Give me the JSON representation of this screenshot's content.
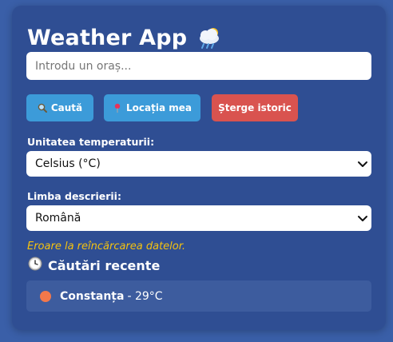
{
  "app": {
    "title": "Weather App"
  },
  "search": {
    "placeholder": "Introdu un oraș...",
    "value": ""
  },
  "buttons": {
    "search_label": "Caută",
    "location_label": "Locația mea",
    "clear_label": "Șterge istoric",
    "search_icon": "magnifier-icon",
    "location_icon": "pin-icon"
  },
  "unit": {
    "label": "Unitatea temperaturii:",
    "selected": "Celsius (°C)"
  },
  "language": {
    "label": "Limba descrierii:",
    "selected": "Română"
  },
  "status": {
    "error": "Eroare la reîncărcarea datelor."
  },
  "recent": {
    "title": "Căutări recente",
    "icon": "clock-icon",
    "items": [
      {
        "city": "Constanța",
        "temp": "- 29°C",
        "dot_color": "#f2784b"
      }
    ]
  },
  "colors": {
    "background": "#3a5fa8",
    "card": "#2f4e93",
    "primary_button": "#3c9bd9",
    "danger_button": "#d9534f",
    "error_text": "#f5c20f"
  }
}
